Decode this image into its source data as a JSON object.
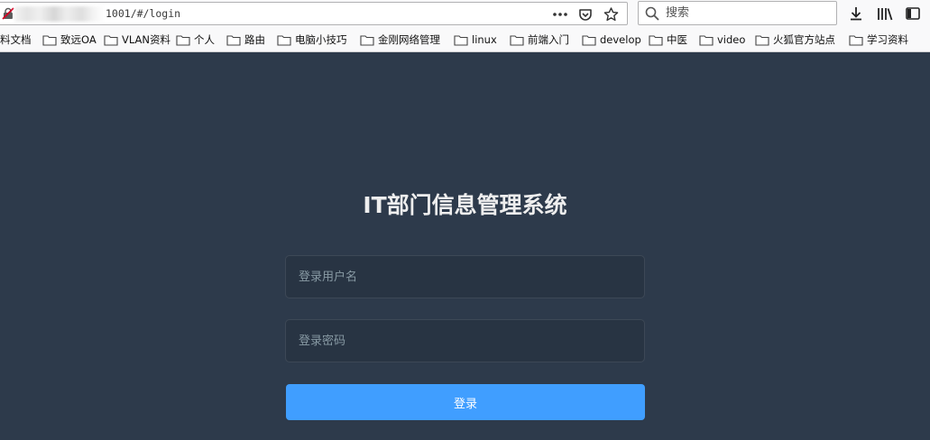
{
  "browser": {
    "url": "1001/#/login",
    "search": {
      "placeholder": "搜索"
    }
  },
  "bookmarks": [
    {
      "label": "料文档"
    },
    {
      "label": "致远OA"
    },
    {
      "label": "VLAN资料"
    },
    {
      "label": "个人"
    },
    {
      "label": "路由"
    },
    {
      "label": "电脑小技巧"
    },
    {
      "label": "金刚网络管理"
    },
    {
      "label": "linux"
    },
    {
      "label": "前端入门"
    },
    {
      "label": "develop"
    },
    {
      "label": "中医"
    },
    {
      "label": "video"
    },
    {
      "label": "火狐官方站点"
    },
    {
      "label": "学习资料"
    }
  ],
  "login": {
    "title": "IT部门信息管理系统",
    "username_placeholder": "登录用户名",
    "password_placeholder": "登录密码",
    "submit_label": "登录"
  },
  "colors": {
    "page_background": "#2d3a4b",
    "input_background": "#283443",
    "button": "#409eff",
    "title": "#eeeeee"
  }
}
